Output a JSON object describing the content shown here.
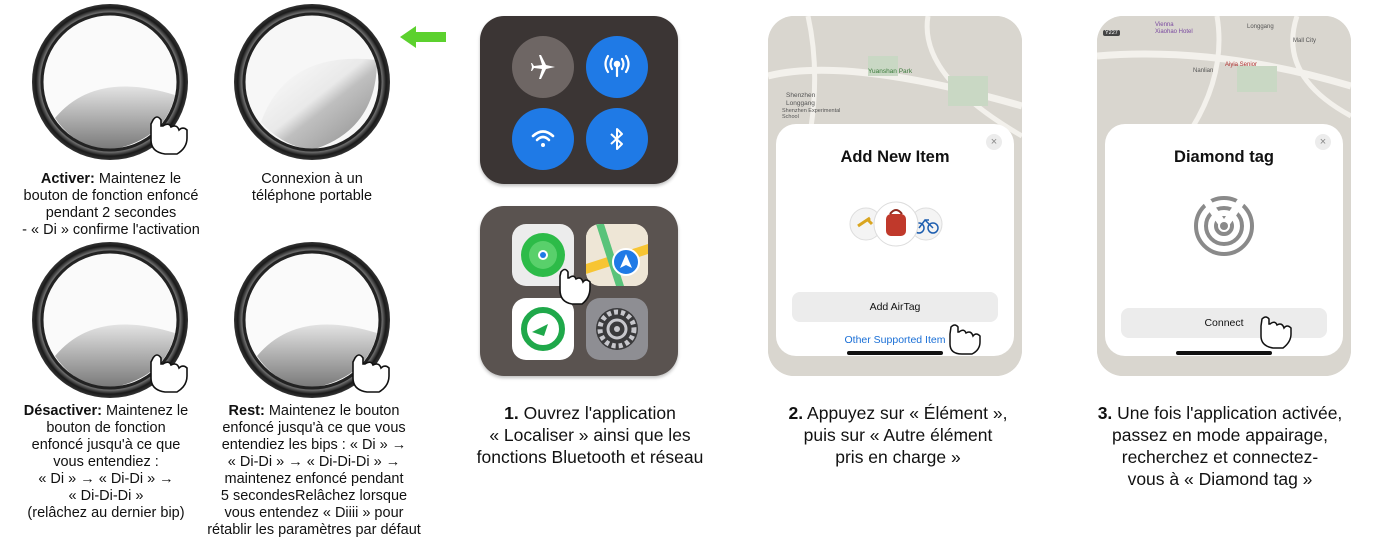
{
  "captions": {
    "activate": {
      "bold": "Activer:",
      "line1": " Maintenez le",
      "line2": "bouton de fonction enfoncé",
      "line3": "pendant 2 secondes",
      "line4": "- « Di » confirme l'activation"
    },
    "connect_phone": {
      "line1": "Connexion à un",
      "line2": "téléphone portable"
    },
    "deactivate": {
      "bold": "Désactiver:",
      "line1": " Maintenez le",
      "line2": "bouton de fonction",
      "line3": "enfoncé jusqu'à ce que",
      "line4": "vous entendiez :",
      "line5": "« Di » → « Di-Di » →",
      "line6": "« Di-Di-Di »",
      "line7": "(relâchez au dernier bip)"
    },
    "reset": {
      "bold": "Rest:",
      "line1": " Maintenez le bouton",
      "line2": "enfoncé jusqu'à ce que vous",
      "line3": "entendiez les bips : « Di » →",
      "line4": "« Di-Di » → « Di-Di-Di » →",
      "line5": "maintenez enfoncé pendant",
      "line6": "5 secondesRelâchez lorsque",
      "line7": "vous entendez « Diiii » pour",
      "line8": "rétablir les paramètres par défaut"
    }
  },
  "steps": {
    "step1": {
      "num": "1.",
      "line1": " Ouvrez l'application",
      "line2": "« Localiser » ainsi que les",
      "line3": "fonctions Bluetooth et réseau"
    },
    "step2": {
      "num": "2.",
      "line1": " Appuyez sur « Élément »,",
      "line2": "puis sur « Autre élément",
      "line3": "pris en charge »"
    },
    "step3": {
      "num": "3.",
      "line1": " Une fois l'application activée,",
      "line2": "passez en mode appairage,",
      "line3": "recherchez et connectez-",
      "line4": "vous à « Diamond tag »"
    }
  },
  "phone2": {
    "map_labels": [
      "Shenzhen",
      "Longgang",
      "Yuanshan Park",
      "Shenzhen Experimental School"
    ],
    "close": "×",
    "title": "Add New Item",
    "button": "Add AirTag",
    "link": "Other Supported Item"
  },
  "phone3": {
    "map_labels": [
      "Y227",
      "Vienna",
      "Xiaohao Hotel",
      "Longgang",
      "Mall City",
      "Nanlian",
      "Aiyia Senior"
    ],
    "close": "×",
    "title": "Diamond tag",
    "button": "Connect"
  },
  "colors": {
    "accent_blue": "#1f7ae6",
    "arrow_green": "#5cd12e",
    "panel_dark": "#3b3534",
    "link_blue": "#1a6fd6"
  }
}
